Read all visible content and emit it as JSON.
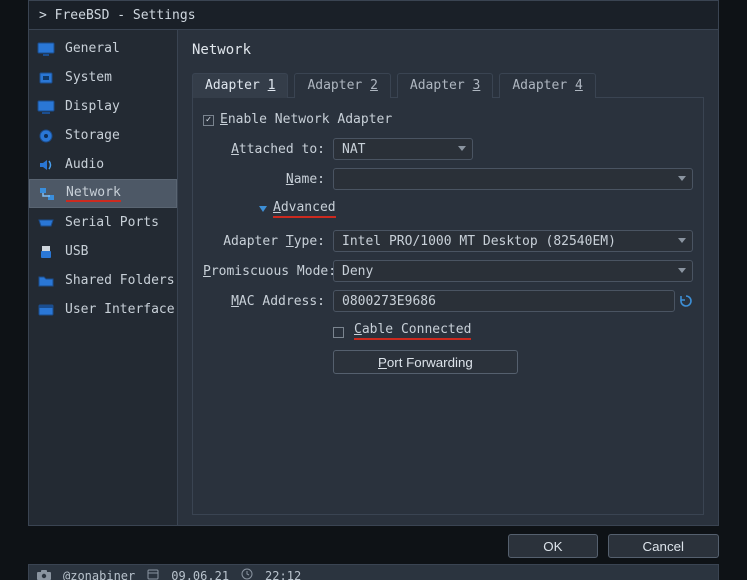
{
  "window": {
    "title": "> FreeBSD - Settings"
  },
  "sidebar": {
    "items": [
      {
        "label": "General"
      },
      {
        "label": "System"
      },
      {
        "label": "Display"
      },
      {
        "label": "Storage"
      },
      {
        "label": "Audio"
      },
      {
        "label": "Network"
      },
      {
        "label": "Serial Ports"
      },
      {
        "label": "USB"
      },
      {
        "label": "Shared Folders"
      },
      {
        "label": "User Interface"
      }
    ]
  },
  "page": {
    "title": "Network"
  },
  "tabs": {
    "prefix": "Adapter ",
    "n1": "1",
    "n2": "2",
    "n3": "3",
    "n4": "4"
  },
  "form": {
    "enable_pre": "E",
    "enable_post": "nable Network Adapter",
    "attached_pre": "A",
    "attached_post": "ttached to:",
    "attached_value": "NAT",
    "name_pre": "N",
    "name_post": "ame:",
    "name_value": "",
    "advanced_pre": "A",
    "advanced_post": "dvanced",
    "adapter_type_pre1": "Adapter ",
    "adapter_type_u": "T",
    "adapter_type_post": "ype:",
    "adapter_type_value": "Intel PRO/1000 MT Desktop (82540EM)",
    "prom_u": "P",
    "prom_post": "romiscuous Mode:",
    "prom_value": "Deny",
    "mac_u": "M",
    "mac_post": "AC Address:",
    "mac_value": "0800273E9686",
    "cable_u": "C",
    "cable_post": "able Connected",
    "pfwd_u": "P",
    "pfwd_post": "ort Forwarding"
  },
  "buttons": {
    "ok": "OK",
    "cancel": "Cancel"
  },
  "status": {
    "user": "@zonabiner",
    "date": "09.06.21",
    "time": "22:12"
  }
}
